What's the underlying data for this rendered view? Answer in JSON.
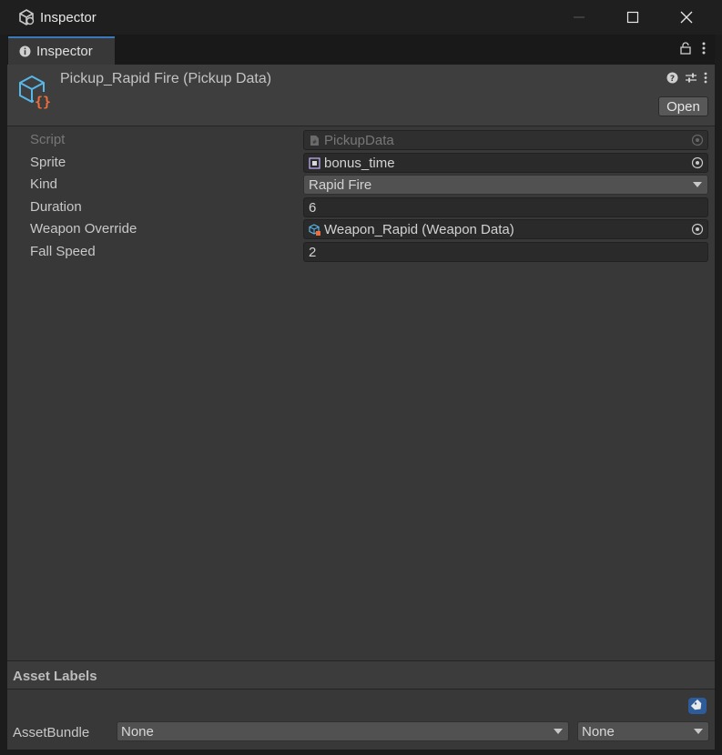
{
  "window": {
    "title": "Inspector"
  },
  "tab": {
    "label": "Inspector"
  },
  "header": {
    "asset_title": "Pickup_Rapid Fire (Pickup Data)",
    "open_label": "Open"
  },
  "properties": [
    {
      "label": "Script",
      "value": "PickupData"
    },
    {
      "label": "Sprite",
      "value": "bonus_time"
    },
    {
      "label": "Kind",
      "value": "Rapid Fire"
    },
    {
      "label": "Duration",
      "value": "6"
    },
    {
      "label": "Weapon Override",
      "value": "Weapon_Rapid (Weapon Data)"
    },
    {
      "label": "Fall Speed",
      "value": "2"
    }
  ],
  "asset_labels": {
    "title": "Asset Labels"
  },
  "asset_bundle": {
    "label": "AssetBundle",
    "name_value": "None",
    "variant_value": "None"
  },
  "colors": {
    "accent": "#3a79bb",
    "asset_icon_blue": "#58b6e8",
    "asset_icon_orange": "#ef6d3a",
    "tag_button": "#2e5c9a"
  },
  "icons": [
    "unity-app-icon",
    "minimize-icon",
    "maximize-icon",
    "close-icon",
    "info-icon",
    "lock-icon",
    "kebab-menu-icon",
    "help-icon",
    "preset-icon",
    "scriptable-object-icon",
    "script-file-icon",
    "sprite-icon",
    "object-picker-icon",
    "tag-icon"
  ]
}
